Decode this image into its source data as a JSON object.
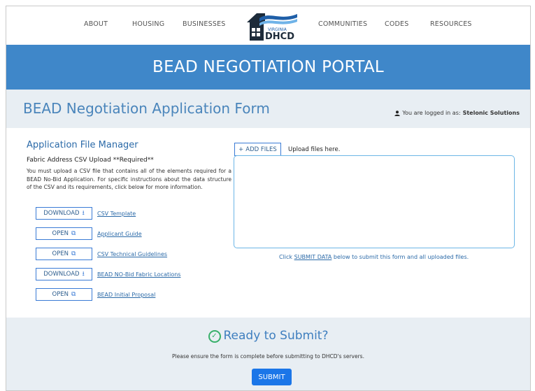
{
  "nav": {
    "about": "ABOUT",
    "housing": "HOUSING",
    "businesses": "BUSINESSES",
    "communities": "COMMUNITIES",
    "codes": "CODES",
    "resources": "RESOURCES"
  },
  "logo": {
    "virginia": "VIRGINIA",
    "dhcd": "DHCD"
  },
  "banner": {
    "title": "BEAD NEGOTIATION PORTAL"
  },
  "form": {
    "title": "BEAD Negotiation Application Form",
    "logged_prefix": "You are logged in as:",
    "user": "Stelonic Solutions"
  },
  "file_manager": {
    "heading": "Application File Manager",
    "csv_label": "Fabric Address CSV Upload **Required**",
    "description": "You must upload a CSV file that contains all of the elements required for a BEAD No-Bid Application. For specific instructions about the data structure of the CSV and its requirements, click below for more information.",
    "resources": [
      {
        "button": "DOWNLOAD",
        "icon": "download-icon",
        "link": "CSV Template"
      },
      {
        "button": "OPEN",
        "icon": "external-link-icon",
        "link": "Applicant Guide"
      },
      {
        "button": "OPEN",
        "icon": "external-link-icon",
        "link": "CSV Technical Guidelines"
      },
      {
        "button": "DOWNLOAD",
        "icon": "download-icon",
        "link": "BEAD NO-Bid Fabric Locations"
      },
      {
        "button": "OPEN",
        "icon": "external-link-icon",
        "link": "BEAD Initial Proposal"
      }
    ]
  },
  "upload": {
    "add_files": "ADD FILES",
    "hint": "Upload files here.",
    "note_before": "Click ",
    "note_link": "SUBMIT DATA",
    "note_after": " below to submit this form and all uploaded files."
  },
  "submit_section": {
    "title": "Ready to Submit?",
    "note": "Please ensure the form is complete before submitting to DHCD's servers.",
    "button": "SUBMIT"
  },
  "colors": {
    "banner": "#3f87c9",
    "band": "#e8eef3",
    "primary": "#1b76e8",
    "heading": "#4a85bb",
    "success": "#38b06a"
  }
}
